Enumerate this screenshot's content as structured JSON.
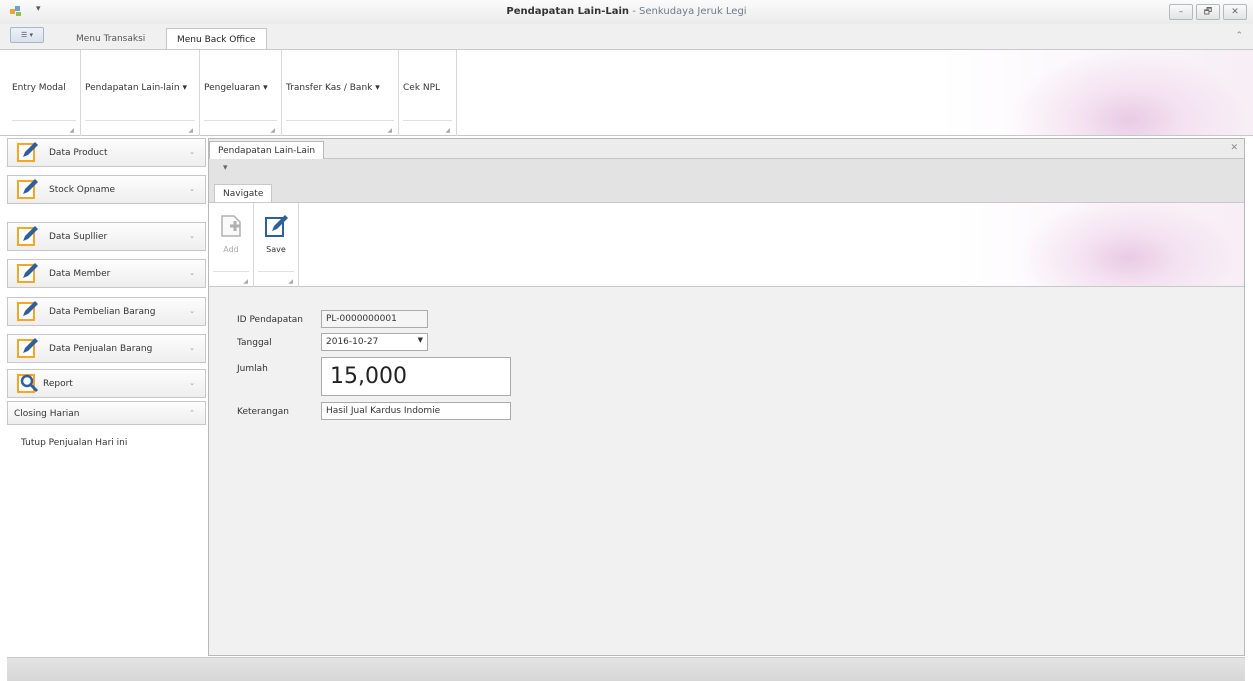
{
  "window": {
    "title_main": "Pendapatan Lain-Lain",
    "title_sep": "-",
    "title_sub": "Senkudaya Jeruk Legi",
    "quick_access": "▾",
    "controls": {
      "minimize": "–",
      "restore": "🗗",
      "close": "✕"
    }
  },
  "ribbon": {
    "app_button": "☰ ▾",
    "tabs": [
      {
        "label": "Menu Transaksi",
        "active": false
      },
      {
        "label": "Menu Back Office",
        "active": true
      }
    ],
    "minimize_glyph": "⌃",
    "buttons": [
      {
        "label": "Entry Modal"
      },
      {
        "label": "Pendapatan Lain-lain ▾"
      },
      {
        "label": "Pengeluaran ▾"
      },
      {
        "label": "Transfer Kas / Bank ▾"
      },
      {
        "label": "Cek NPL"
      }
    ],
    "launcher_glyph": "◢"
  },
  "sidebar": {
    "groups": [
      {
        "label": "Data Product",
        "icon": "pencil-icon"
      },
      {
        "label": "Stock Opname",
        "icon": "pencil-icon"
      },
      {
        "label": "Data Supllier",
        "icon": "pencil-icon"
      },
      {
        "label": "Data Member",
        "icon": "pencil-icon"
      },
      {
        "label": "Data Pembelian Barang",
        "icon": "pencil-icon"
      },
      {
        "label": "Data Penjualan Barang",
        "icon": "pencil-icon"
      },
      {
        "label": "Report",
        "icon": "magnifier-icon"
      }
    ],
    "expanded_group": "Closing Harian",
    "expanded_items": [
      "Tutup Penjualan Hari ini"
    ],
    "chevron_collapsed": "⌄",
    "chevron_expanded": "⌃"
  },
  "document": {
    "tab_label": "Pendapatan Lain-Lain",
    "close_glyph": "✕",
    "quick_access": "▾",
    "inner_tab": "Navigate",
    "buttons": [
      {
        "label": "Add",
        "icon": "add-icon",
        "enabled": false
      },
      {
        "label": "Save",
        "icon": "save-pencil-icon",
        "enabled": true
      }
    ],
    "launcher_glyph": "◢"
  },
  "form": {
    "id_label": "ID Pendapatan",
    "id_value": "PL-0000000001",
    "date_label": "Tanggal",
    "date_value": "2016-10-27",
    "date_arrow": "▼",
    "amount_label": "Jumlah",
    "amount_value": "15,000",
    "note_label": "Keterangan",
    "note_value": "Hasil Jual Kardus Indomie"
  },
  "colors": {
    "accent_orange": "#f5a623",
    "icon_blue": "#2f5e9e"
  }
}
